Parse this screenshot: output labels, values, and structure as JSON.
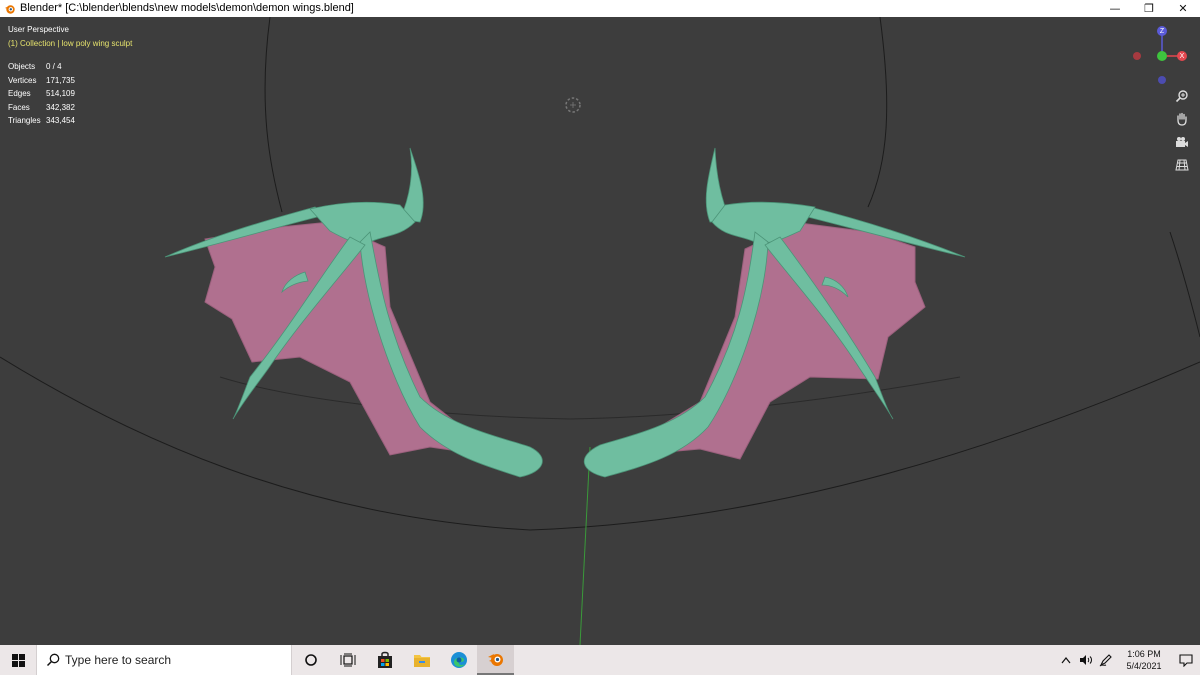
{
  "window": {
    "title": "Blender* [C:\\blender\\blends\\new models\\demon\\demon wings.blend]",
    "minimize_glyph": "—",
    "restore_glyph": "❐",
    "close_glyph": "✕"
  },
  "viewport": {
    "view_name": "User Perspective",
    "collection_line": "(1) Collection | low poly wing sculpt",
    "stats": [
      {
        "label": "Objects",
        "value": "0 / 4"
      },
      {
        "label": "Vertices",
        "value": "171,735"
      },
      {
        "label": "Edges",
        "value": "514,109"
      },
      {
        "label": "Faces",
        "value": "342,382"
      },
      {
        "label": "Triangles",
        "value": "343,454"
      }
    ],
    "gizmo": {
      "z_label": "Z",
      "x_label": "X",
      "colors": {
        "x": "#e5474f",
        "y": "#3ec43e",
        "z": "#5b5bd8"
      }
    },
    "nav_tools": [
      "zoom-icon",
      "hand-pan-icon",
      "camera-icon",
      "grid-ortho-icon"
    ],
    "mesh_colors": {
      "bone": "#6fbea0",
      "membrane": "#b0708f"
    }
  },
  "taskbar": {
    "search_placeholder": "Type here to search",
    "apps": [
      "cortana-icon",
      "task-view-icon",
      "store-icon",
      "file-explorer-icon",
      "edge-icon",
      "blender-icon"
    ],
    "clock_time": "1:06 PM",
    "clock_date": "5/4/2021"
  }
}
